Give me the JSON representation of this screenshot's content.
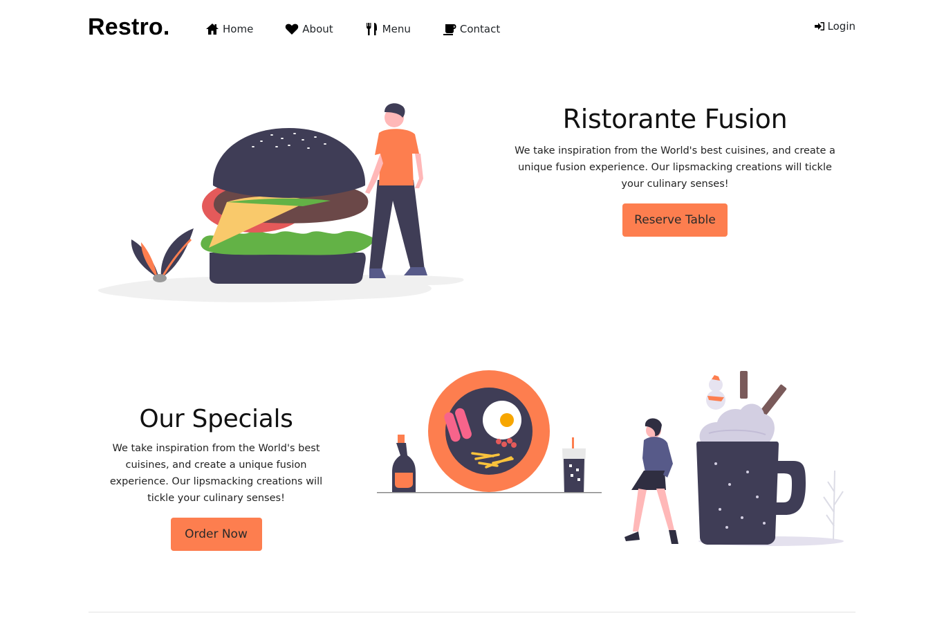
{
  "brand": "Restro.",
  "nav": {
    "items": [
      {
        "label": "Home",
        "icon": "home-icon"
      },
      {
        "label": "About",
        "icon": "heart-icon"
      },
      {
        "label": "Menu",
        "icon": "utensils-icon"
      },
      {
        "label": "Contact",
        "icon": "coffee-icon"
      }
    ],
    "login": {
      "label": "Login",
      "icon": "sign-in-icon"
    }
  },
  "hero": {
    "title": "Ristorante Fusion",
    "description": "We take inspiration from the World's best cuisines, and create a unique fusion experience. Our lipsmacking creations will tickle your culinary senses!",
    "button": "Reserve Table"
  },
  "specials": {
    "title": "Our Specials",
    "description": "We take inspiration from the World's best cuisines, and create a unique fusion experience. Our lipsmacking creations will tickle your culinary senses!",
    "button": "Order Now"
  },
  "colors": {
    "accent": "#fd7e4f",
    "dark": "#3f3d56",
    "text": "#212529"
  }
}
